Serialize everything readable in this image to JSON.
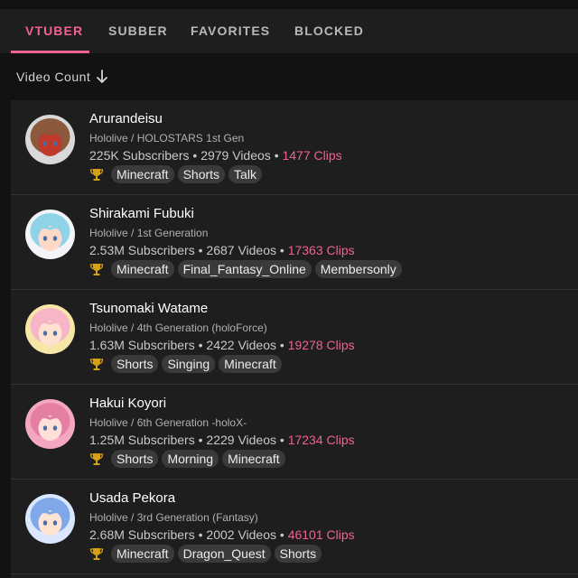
{
  "tabs": [
    {
      "label": "VTUBER",
      "active": true
    },
    {
      "label": "SUBBER",
      "active": false
    },
    {
      "label": "FAVORITES",
      "active": false
    },
    {
      "label": "BLOCKED",
      "active": false
    }
  ],
  "sort": {
    "label": "Video Count",
    "icon": "arrow-down-icon"
  },
  "colors": {
    "accent": "#f06292",
    "background": "#121212",
    "surface": "#1e1e1e",
    "chip": "#3a3a3a",
    "trophy": "#d4a017"
  },
  "vtubers": [
    {
      "name": "Arurandeisu",
      "org": "Hololive / HOLOSTARS 1st Gen",
      "subscribers": "225K Subscribers",
      "videos": "2979 Videos",
      "clips": "1477 Clips",
      "tags": [
        "Minecraft",
        "Shorts",
        "Talk"
      ],
      "avatar_colors": [
        "#d9d9d9",
        "#8b5a3c",
        "#c0392b"
      ]
    },
    {
      "name": "Shirakami Fubuki",
      "org": "Hololive / 1st Generation",
      "subscribers": "2.53M Subscribers",
      "videos": "2687 Videos",
      "clips": "17363 Clips",
      "tags": [
        "Minecraft",
        "Final_Fantasy_Online",
        "Membersonly"
      ],
      "avatar_colors": [
        "#f2f4f8",
        "#8fd3e8",
        "#ffd9c7"
      ]
    },
    {
      "name": "Tsunomaki Watame",
      "org": "Hololive / 4th Generation (holoForce)",
      "subscribers": "1.63M Subscribers",
      "videos": "2422 Videos",
      "clips": "19278 Clips",
      "tags": [
        "Shorts",
        "Singing",
        "Minecraft"
      ],
      "avatar_colors": [
        "#f6e7a8",
        "#f7b6c8",
        "#ffe1d0"
      ]
    },
    {
      "name": "Hakui Koyori",
      "org": "Hololive / 6th Generation -holoX-",
      "subscribers": "1.25M Subscribers",
      "videos": "2229 Videos",
      "clips": "17234 Clips",
      "tags": [
        "Shorts",
        "Morning",
        "Minecraft"
      ],
      "avatar_colors": [
        "#f4a7c0",
        "#e47fa2",
        "#ffe0d8"
      ]
    },
    {
      "name": "Usada Pekora",
      "org": "Hololive / 3rd Generation (Fantasy)",
      "subscribers": "2.68M Subscribers",
      "videos": "2002 Videos",
      "clips": "46101 Clips",
      "tags": [
        "Minecraft",
        "Dragon_Quest",
        "Shorts"
      ],
      "avatar_colors": [
        "#dbe7ff",
        "#7fa8e8",
        "#ffe3d3"
      ]
    }
  ]
}
